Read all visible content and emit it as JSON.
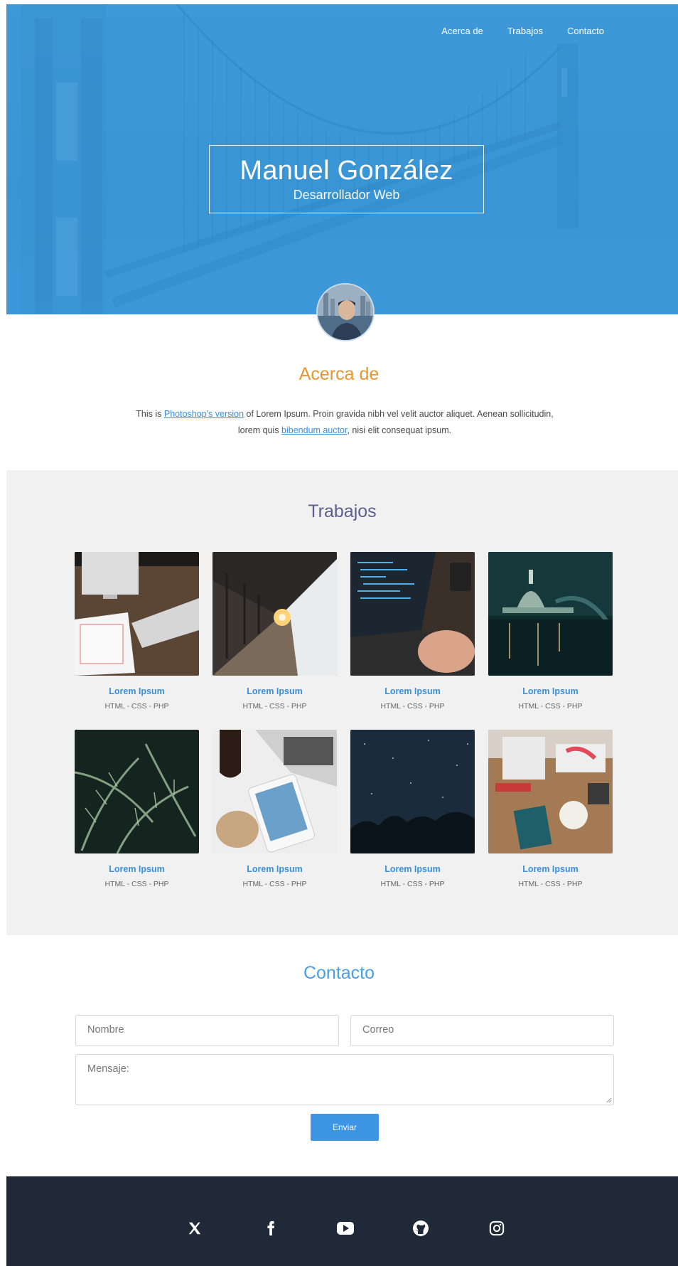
{
  "nav": {
    "items": [
      "Acerca de",
      "Trabajos",
      "Contacto"
    ]
  },
  "hero": {
    "name": "Manuel González",
    "role": "Desarrollador Web"
  },
  "about": {
    "title": "Acerca de",
    "text_1": "This is ",
    "link_1": "Photoshop's version",
    "text_2": " of Lorem Ipsum. Proin gravida nibh vel velit auctor aliquet. Aenean sollicitudin, lorem quis ",
    "link_2": "bibendum auctor",
    "text_3": ", nisi elit consequat ipsum."
  },
  "works": {
    "title": "Trabajos",
    "items": [
      {
        "title": "Lorem Ipsum",
        "tags": "HTML - CSS - PHP"
      },
      {
        "title": "Lorem Ipsum",
        "tags": "HTML - CSS - PHP"
      },
      {
        "title": "Lorem Ipsum",
        "tags": "HTML - CSS - PHP"
      },
      {
        "title": "Lorem Ipsum",
        "tags": "HTML - CSS - PHP"
      },
      {
        "title": "Lorem Ipsum",
        "tags": "HTML - CSS - PHP"
      },
      {
        "title": "Lorem Ipsum",
        "tags": "HTML - CSS - PHP"
      },
      {
        "title": "Lorem Ipsum",
        "tags": "HTML - CSS - PHP"
      },
      {
        "title": "Lorem Ipsum",
        "tags": "HTML - CSS - PHP"
      }
    ]
  },
  "contact": {
    "title": "Contacto",
    "name_placeholder": "Nombre",
    "email_placeholder": "Correo",
    "message_placeholder": "Mensaje:",
    "send_label": "Enviar"
  },
  "footer": {
    "social_icons": [
      "x-icon",
      "facebook-icon",
      "youtube-icon",
      "github-icon",
      "instagram-icon"
    ]
  },
  "colors": {
    "hero": "#3d99d9",
    "accent_orange": "#e8952f",
    "link_blue": "#3a8fdc",
    "button": "#3d95e4",
    "footer": "#1f2937",
    "works_bg": "#f1f1f1"
  }
}
